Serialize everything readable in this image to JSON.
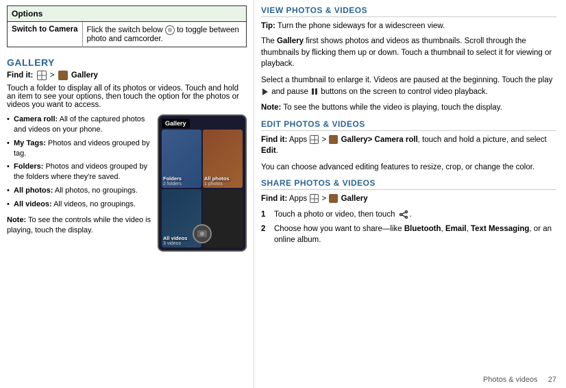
{
  "options_table": {
    "header": "Options",
    "rows": [
      {
        "col1": "Switch to Camera",
        "col2": "Flick the switch below  to toggle between photo and camcorder."
      }
    ]
  },
  "gallery_section": {
    "title": "GALLERY",
    "find_it_prefix": "Find it:",
    "find_it_apps": "Apps",
    "find_it_arrow": ">",
    "find_it_gallery": "Gallery",
    "touch_folder_text": "Touch a folder to display all of its photos or videos. Touch and hold an item to see your options, then touch the option for the photos or videos you want to access.",
    "bullets": [
      {
        "label": "Camera roll:",
        "text": "All of the captured photos and videos on your phone."
      },
      {
        "label": "My Tags:",
        "text": "Photos and videos grouped by tag."
      },
      {
        "label": "Folders:",
        "text": "Photos and videos grouped by the folders where they're saved."
      },
      {
        "label": "All photos:",
        "text": "All photos, no groupings."
      },
      {
        "label": "All videos:",
        "text": "All videos, no groupings."
      }
    ],
    "note_bottom_label": "Note:",
    "note_bottom_text": "To see the controls while the video is playing, touch the display."
  },
  "phone_mockup": {
    "gallery_label": "Gallery",
    "cells": [
      {
        "label": "Folders",
        "sublabel": "2 folders"
      },
      {
        "label": "All photos",
        "sublabel": "1 photos"
      },
      {
        "label": "All videos",
        "sublabel": "3 videos"
      }
    ]
  },
  "view_section": {
    "heading": "VIEW PHOTOS & VIDEOS",
    "tip_label": "Tip:",
    "tip_text": "Turn the phone sideways for a widescreen view.",
    "para1": "The Gallery first shows photos and videos as thumbnails. Scroll through the thumbnails by flicking them up or down. Touch a thumbnail to select it for viewing or playback.",
    "para2_prefix": "Select a thumbnail to enlarge it. Videos are paused at the beginning. Touch the play",
    "para2_middle": "and pause",
    "para2_suffix": "buttons on the screen to control video playback.",
    "note_label": "Note:",
    "note_text": "To see the buttons while the video is playing, touch the display."
  },
  "edit_section": {
    "heading": "EDIT PHOTOS & VIDEOS",
    "find_it_prefix": "Find it:",
    "find_it_apps": "Apps",
    "find_it_arrow": ">",
    "find_it_gallery": "Gallery>",
    "find_it_extra": "Camera roll",
    "find_it_suffix": ", touch and hold a picture, and select",
    "find_it_edit": "Edit",
    "para": "You can choose advanced editing features to resize, crop, or change the color."
  },
  "share_section": {
    "heading": "SHARE PHOTOS & VIDEOS",
    "find_it_prefix": "Find it:",
    "find_it_apps": "Apps",
    "find_it_arrow": ">",
    "find_it_gallery": "Gallery",
    "steps": [
      {
        "num": "1",
        "text_prefix": "Touch a photo or video, then touch"
      },
      {
        "num": "2",
        "text_prefix": "Choose how you want to share—like",
        "bold1": "Bluetooth",
        "sep1": ",",
        "bold2": "Email",
        "sep2": ",",
        "bold3": "Text Messaging",
        "text_suffix": ", or an online album."
      }
    ]
  },
  "footer": {
    "text": "Photos & videos",
    "page": "27"
  }
}
